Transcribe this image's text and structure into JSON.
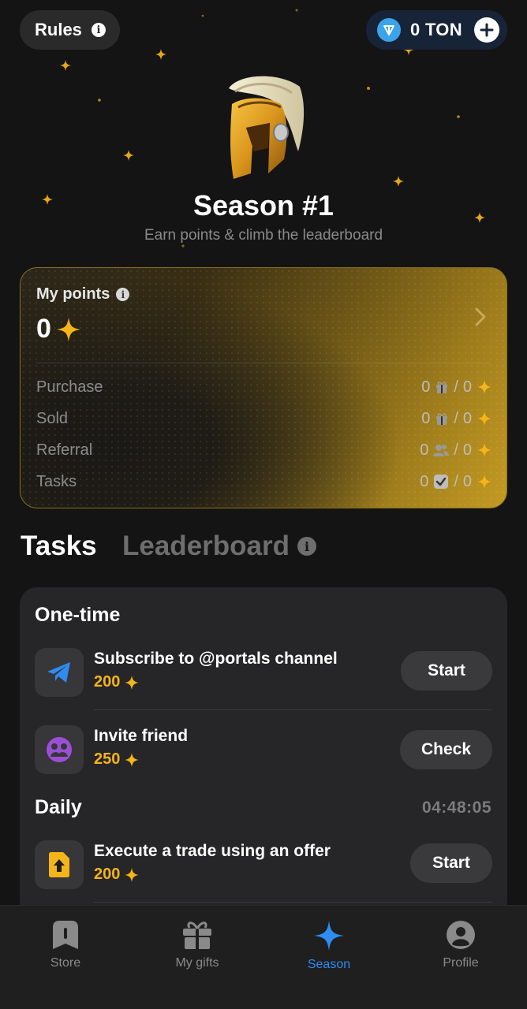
{
  "header": {
    "rules_label": "Rules",
    "balance_label": "0 TON"
  },
  "hero": {
    "title": "Season #1",
    "subtitle": "Earn points & climb the leaderboard"
  },
  "points_card": {
    "label": "My points",
    "value": "0",
    "rows": [
      {
        "name": "Purchase",
        "count": "0",
        "icon": "gift-icon",
        "points": "0"
      },
      {
        "name": "Sold",
        "count": "0",
        "icon": "gift-icon",
        "points": "0"
      },
      {
        "name": "Referral",
        "count": "0",
        "icon": "users-icon",
        "points": "0"
      },
      {
        "name": "Tasks",
        "count": "0",
        "icon": "check-square-icon",
        "points": "0"
      }
    ]
  },
  "tabs": {
    "tasks": "Tasks",
    "leaderboard": "Leaderboard"
  },
  "tasks": {
    "one_time_heading": "One-time",
    "daily_heading": "Daily",
    "daily_timer": "04:48:05",
    "items": [
      {
        "title": "Subscribe to @portals channel",
        "reward": "200",
        "action": "Start",
        "icon": "telegram-icon"
      },
      {
        "title": "Invite friend",
        "reward": "250",
        "action": "Check",
        "icon": "friends-icon"
      },
      {
        "title": "Execute a trade using an offer",
        "reward": "200",
        "action": "Start",
        "icon": "upload-file-icon"
      }
    ]
  },
  "nav": {
    "items": [
      {
        "label": "Store",
        "icon": "store-icon"
      },
      {
        "label": "My gifts",
        "icon": "gift-icon"
      },
      {
        "label": "Season",
        "icon": "sparkle-icon"
      },
      {
        "label": "Profile",
        "icon": "profile-icon"
      }
    ],
    "active": "Season"
  },
  "colors": {
    "accent_gold": "#f4b41a",
    "accent_blue": "#2f8cf0",
    "ton_blue": "#3aa3ea"
  }
}
